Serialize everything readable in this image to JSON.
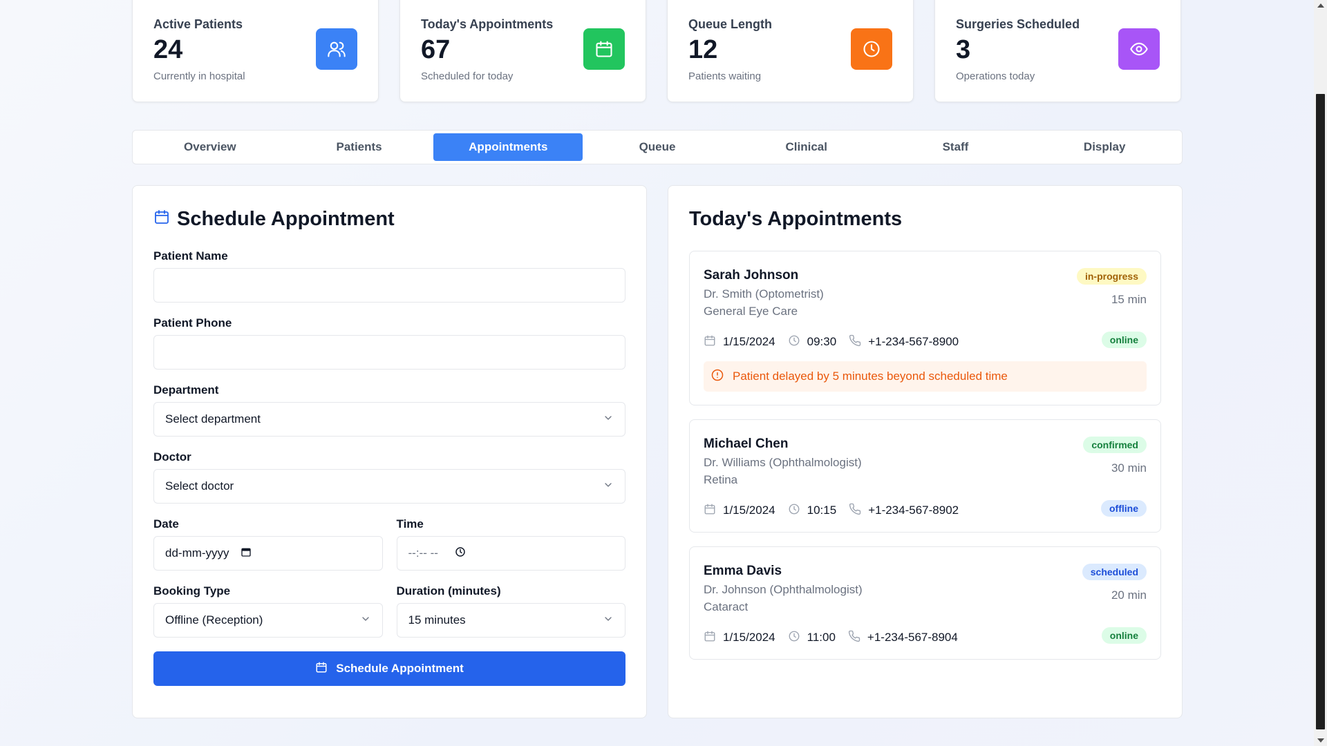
{
  "stats": [
    {
      "title": "Active Patients",
      "value": "24",
      "sub": "Currently in hospital",
      "icon": "users-icon",
      "color": "#3b82f6"
    },
    {
      "title": "Today's Appointments",
      "value": "67",
      "sub": "Scheduled for today",
      "icon": "calendar-icon",
      "color": "#22c55e"
    },
    {
      "title": "Queue Length",
      "value": "12",
      "sub": "Patients waiting",
      "icon": "clock-icon",
      "color": "#f97316"
    },
    {
      "title": "Surgeries Scheduled",
      "value": "3",
      "sub": "Operations today",
      "icon": "eye-icon",
      "color": "#a855f7"
    }
  ],
  "tabs": [
    "Overview",
    "Patients",
    "Appointments",
    "Queue",
    "Clinical",
    "Staff",
    "Display"
  ],
  "active_tab": "Appointments",
  "form": {
    "title": "Schedule Appointment",
    "patient_name_label": "Patient Name",
    "patient_name_value": "",
    "patient_phone_label": "Patient Phone",
    "patient_phone_value": "",
    "department_label": "Department",
    "department_value": "Select department",
    "doctor_label": "Doctor",
    "doctor_value": "Select doctor",
    "date_label": "Date",
    "date_value": "dd-mm-yyyy",
    "time_label": "Time",
    "time_value": "--:-- --",
    "booking_type_label": "Booking Type",
    "booking_type_value": "Offline (Reception)",
    "duration_label": "Duration (minutes)",
    "duration_value": "15 minutes",
    "submit_label": "Schedule Appointment"
  },
  "appointments_panel": {
    "title": "Today's Appointments",
    "items": [
      {
        "name": "Sarah Johnson",
        "doctor": "Dr. Smith (Optometrist)",
        "department": "General Eye Care",
        "status": "in-progress",
        "duration": "15 min",
        "date": "1/15/2024",
        "time": "09:30",
        "phone": "+1-234-567-8900",
        "mode": "online",
        "alert": "Patient delayed by 5 minutes beyond scheduled time"
      },
      {
        "name": "Michael Chen",
        "doctor": "Dr. Williams (Ophthalmologist)",
        "department": "Retina",
        "status": "confirmed",
        "duration": "30 min",
        "date": "1/15/2024",
        "time": "10:15",
        "phone": "+1-234-567-8902",
        "mode": "offline"
      },
      {
        "name": "Emma Davis",
        "doctor": "Dr. Johnson (Ophthalmologist)",
        "department": "Cataract",
        "status": "scheduled",
        "duration": "20 min",
        "date": "1/15/2024",
        "time": "11:00",
        "phone": "+1-234-567-8904",
        "mode": "online"
      }
    ]
  },
  "colors": {
    "primary": "#2563eb",
    "tab_active": "#3b82f6",
    "status_in_progress_bg": "#fef9c3",
    "status_in_progress_fg": "#a16207",
    "status_confirmed_bg": "#dcfce7",
    "status_confirmed_fg": "#15803d",
    "status_scheduled_bg": "#dbeafe",
    "status_scheduled_fg": "#1d4ed8",
    "mode_online_bg": "#dcfce7",
    "mode_online_fg": "#15803d",
    "mode_offline_bg": "#dbeafe",
    "mode_offline_fg": "#1d4ed8",
    "alert_fg": "#ea580c"
  }
}
